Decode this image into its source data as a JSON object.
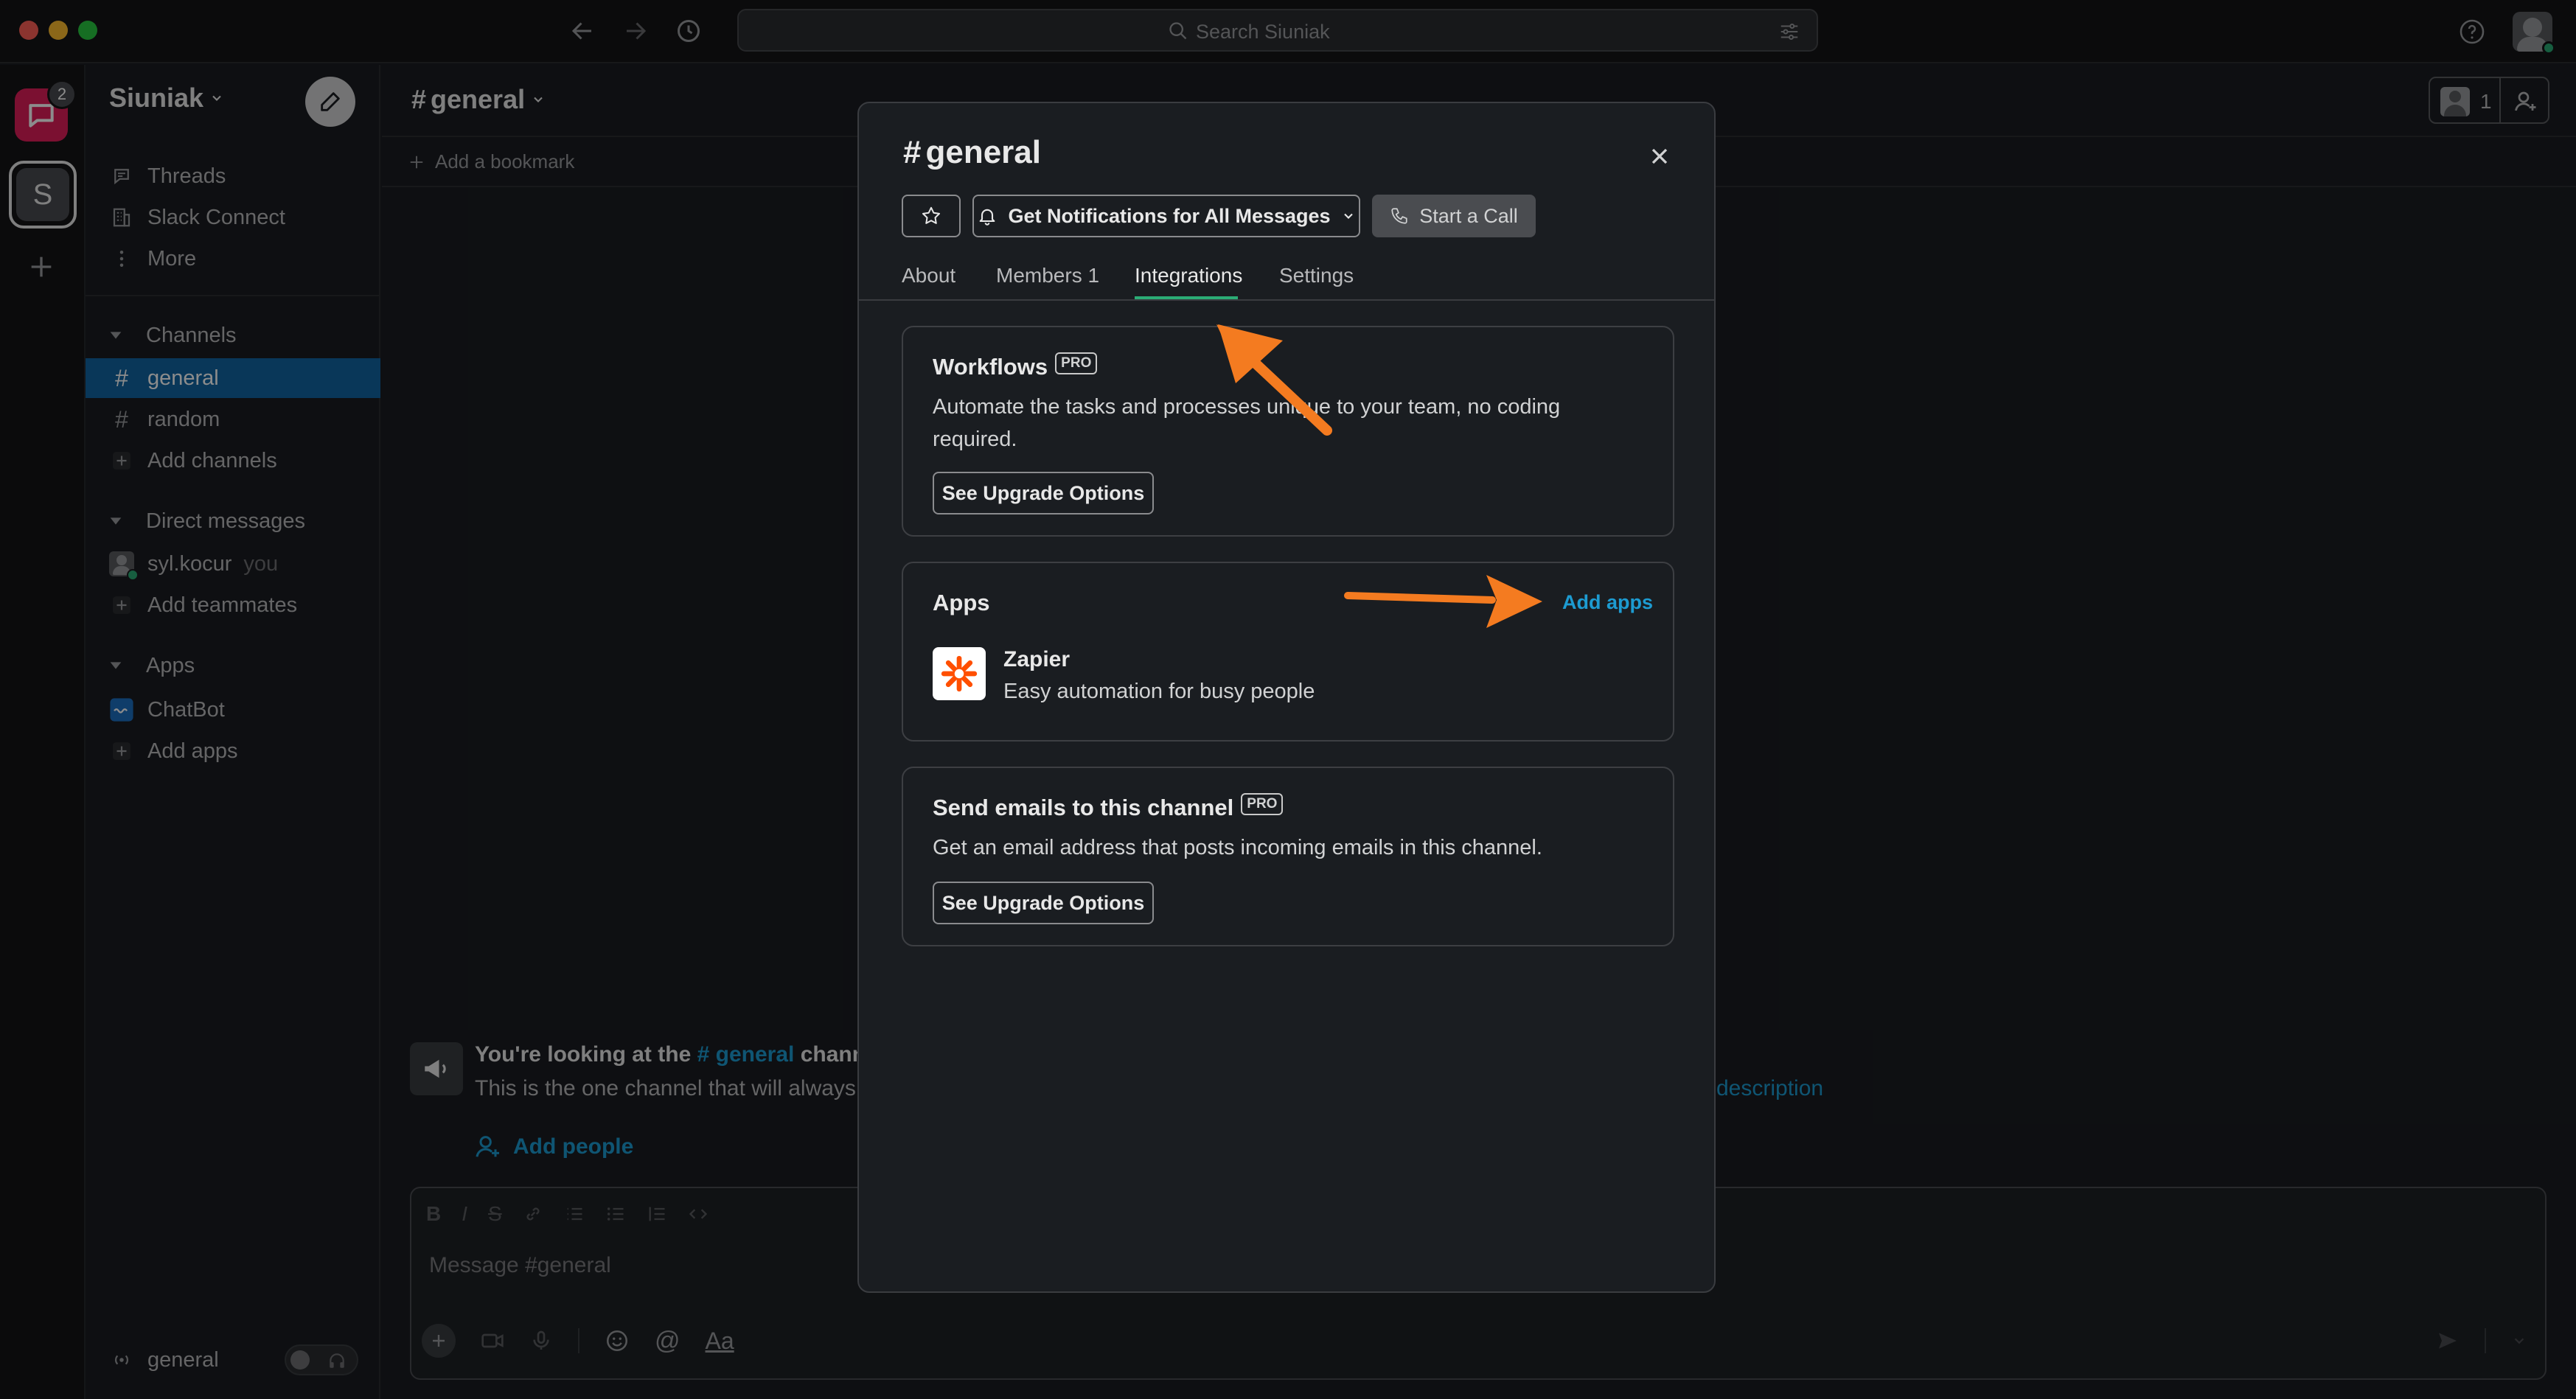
{
  "titlebar": {
    "search_placeholder": "Search Siuniak"
  },
  "rail": {
    "badge_count": "2",
    "workspace_initial": "S"
  },
  "sidebar": {
    "workspace_name": "Siuniak",
    "top_items": [
      {
        "label": "Threads",
        "icon": "threads-icon"
      },
      {
        "label": "Slack Connect",
        "icon": "building-icon"
      },
      {
        "label": "More",
        "icon": "more-vertical-icon"
      }
    ],
    "channels_header": "Channels",
    "channels": [
      {
        "label": "general",
        "active": true
      },
      {
        "label": "random",
        "active": false
      }
    ],
    "add_channels": "Add channels",
    "dm_header": "Direct messages",
    "dm_user": "syl.kocur",
    "dm_you": "you",
    "add_teammates": "Add teammates",
    "apps_header": "Apps",
    "app_item": "ChatBot",
    "add_apps": "Add apps",
    "footer_channel": "general"
  },
  "main": {
    "channel_title": "general",
    "add_bookmark": "Add a bookmark",
    "member_count": "1",
    "intro_title_prefix": "You're looking at the",
    "intro_channel": "# general",
    "intro_title_suffix": "channe",
    "intro_body": "This is the one channel that will always i",
    "intro_desc_link": "description",
    "add_people": "Add people",
    "composer_placeholder": "Message #general",
    "composer_aa": "Aa"
  },
  "modal": {
    "title": "general",
    "notifications_label": "Get Notifications for All Messages",
    "start_call_label": "Start a Call",
    "tabs": [
      "About",
      "Members 1",
      "Integrations",
      "Settings"
    ],
    "active_tab": "Integrations",
    "workflows": {
      "title": "Workflows",
      "badge": "PRO",
      "description": "Automate the tasks and processes unique to your team, no coding required.",
      "button": "See Upgrade Options"
    },
    "apps": {
      "title": "Apps",
      "add_link": "Add apps",
      "app_name": "Zapier",
      "app_desc": "Easy automation for busy people"
    },
    "emails": {
      "title": "Send emails to this channel",
      "badge": "PRO",
      "description": "Get an email address that posts incoming emails in this channel.",
      "button": "See Upgrade Options"
    }
  },
  "colors": {
    "accent_blue": "#1d9bd1",
    "active_channel_bg": "#1164a3",
    "annotation_arrow": "#f47b20",
    "zapier_orange": "#ff4f00"
  }
}
